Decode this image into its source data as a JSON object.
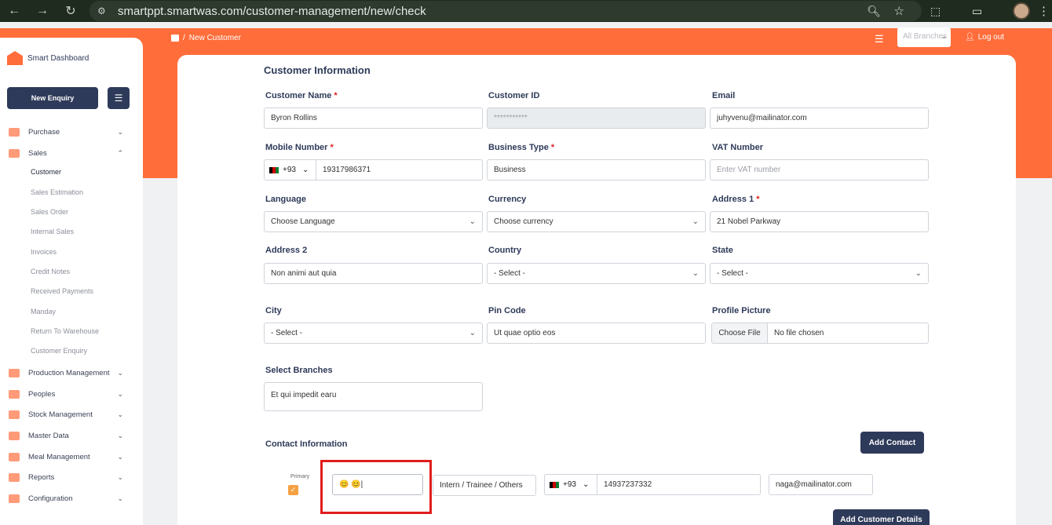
{
  "browser": {
    "url": "smartppt.smartwas.com/customer-management/new/check"
  },
  "header": {
    "breadcrumb": "New Customer",
    "breadcrumb_sep": "/",
    "branch_select": "All Branches",
    "logout": "Log out"
  },
  "sidebar": {
    "brand": "Smart Dashboard",
    "new_enquiry": "New Enquiry",
    "items": [
      {
        "label": "Purchase",
        "chev": "⌄"
      },
      {
        "label": "Sales",
        "chev": "⌃"
      },
      {
        "label": "Production Management",
        "chev": "⌄"
      },
      {
        "label": "Peoples",
        "chev": "⌄"
      },
      {
        "label": "Stock Management",
        "chev": "⌄"
      },
      {
        "label": "Master Data",
        "chev": "⌄"
      },
      {
        "label": "Meal Management",
        "chev": "⌄"
      },
      {
        "label": "Reports",
        "chev": "⌄"
      },
      {
        "label": "Configuration",
        "chev": "⌄"
      }
    ],
    "sales_sub": [
      "Customer",
      "Sales Estimation",
      "Sales Order",
      "Internal Sales",
      "Invoices",
      "Credit Notes",
      "Received Payments",
      "Manday",
      "Return To Warehouse",
      "Customer Enquiry"
    ]
  },
  "form": {
    "title": "Customer Information",
    "customer_name": {
      "label": "Customer Name",
      "value": "Byron Rollins"
    },
    "customer_id": {
      "label": "Customer ID",
      "value": "***********"
    },
    "email": {
      "label": "Email",
      "value": "juhyvenu@mailinator.com"
    },
    "mobile": {
      "label": "Mobile Number",
      "code": "+93",
      "value": "19317986371"
    },
    "business_type": {
      "label": "Business Type",
      "value": "Business"
    },
    "vat": {
      "label": "VAT Number",
      "placeholder": "Enter VAT number"
    },
    "language": {
      "label": "Language",
      "value": "Choose Language"
    },
    "currency": {
      "label": "Currency",
      "value": "Choose currency"
    },
    "address1": {
      "label": "Address 1",
      "value": "21 Nobel Parkway"
    },
    "address2": {
      "label": "Address 2",
      "value": "Non animi aut quia"
    },
    "country": {
      "label": "Country",
      "value": "- Select -"
    },
    "state": {
      "label": "State",
      "value": "- Select -"
    },
    "city": {
      "label": "City",
      "value": "- Select -"
    },
    "pin_code": {
      "label": "Pin Code",
      "value": "Ut quae optio eos"
    },
    "profile_picture": {
      "label": "Profile Picture",
      "button": "Choose File",
      "status": "No file chosen"
    },
    "select_branches": {
      "label": "Select Branches",
      "value": "Et qui impedit earu"
    }
  },
  "contact": {
    "title": "Contact Information",
    "add_contact": "Add Contact",
    "primary_label": "Primary",
    "name_value": "😊 😊|",
    "role_value": "Intern / Trainee / Others",
    "phone_code": "+93",
    "phone_value": "14937237332",
    "email_value": "naga@mailinator.com",
    "add_details": "Add Customer Details"
  }
}
